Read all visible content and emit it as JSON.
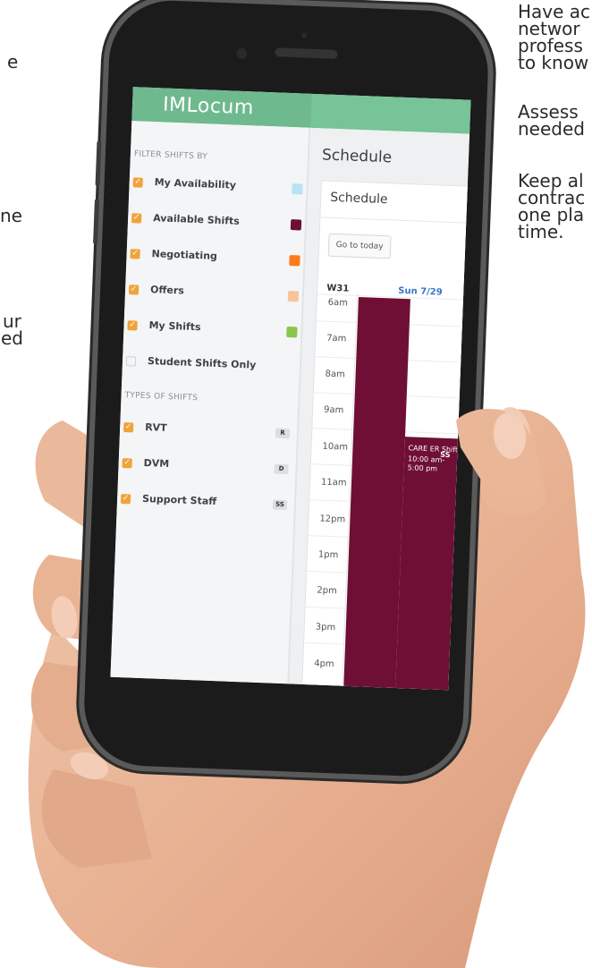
{
  "side_text": {
    "left": [
      "e",
      "ne",
      "ur",
      "ed"
    ],
    "right": [
      "Have ac",
      "networ",
      "profess",
      "to know",
      "Assess",
      "needed",
      "Keep al",
      "contrac",
      "one pla",
      "time."
    ]
  },
  "app": {
    "brand": "IMLocum",
    "sidebar": {
      "filter_title": "FILTER SHIFTS BY",
      "filters": [
        {
          "label": "My Availability",
          "checked": true,
          "color": "#b8e3f3"
        },
        {
          "label": "Available Shifts",
          "checked": true,
          "color": "#6f0f35"
        },
        {
          "label": "Negotiating",
          "checked": true,
          "color": "#ff7a1a"
        },
        {
          "label": "Offers",
          "checked": true,
          "color": "#f8c49c"
        },
        {
          "label": "My Shifts",
          "checked": true,
          "color": "#8cc54b"
        },
        {
          "label": "Student Shifts Only",
          "checked": false,
          "color": ""
        }
      ],
      "types_title": "TYPES OF SHIFTS",
      "types": [
        {
          "label": "RVT",
          "checked": true,
          "tag": "R"
        },
        {
          "label": "DVM",
          "checked": true,
          "tag": "D"
        },
        {
          "label": "Support Staff",
          "checked": true,
          "tag": "SS"
        }
      ]
    },
    "main": {
      "title": "Schedule",
      "card_title": "Schedule",
      "today_button": "Go to today",
      "week": "W31",
      "day": "Sun 7/29",
      "hours": [
        "6am",
        "7am",
        "8am",
        "9am",
        "10am",
        "11am",
        "12pm",
        "1pm",
        "2pm",
        "3pm",
        "4pm"
      ],
      "event": {
        "title": "CARE ER Shift",
        "badge": "SS",
        "time_line1": "10:00 am-",
        "time_line2": "5:00 pm",
        "color": "#6f0f35"
      }
    }
  }
}
